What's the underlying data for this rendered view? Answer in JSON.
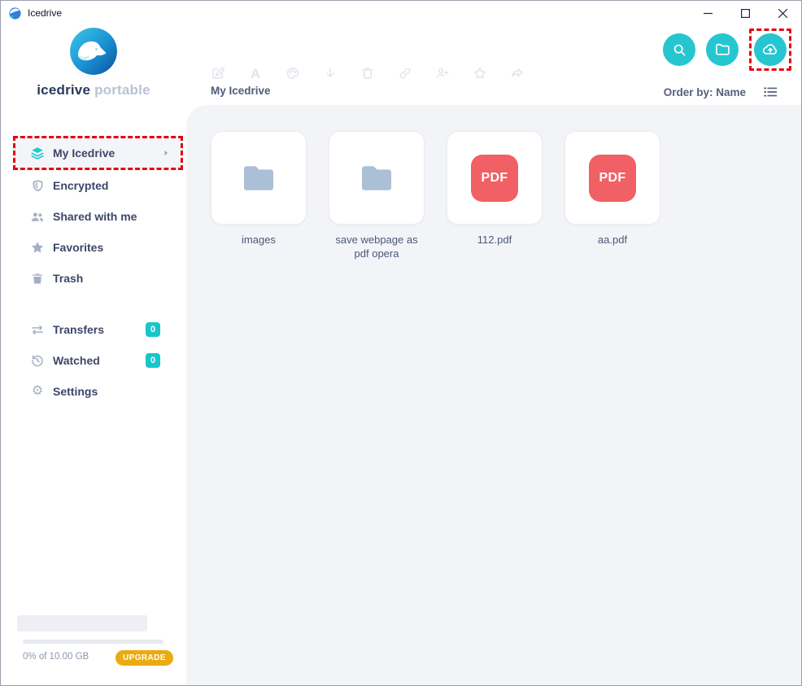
{
  "window": {
    "title": "Icedrive"
  },
  "sidebar": {
    "brand": {
      "name": "icedrive",
      "suffix": "portable"
    },
    "items": [
      {
        "label": "My Icedrive",
        "icon": "layers-icon",
        "selected": true
      },
      {
        "label": "Encrypted",
        "icon": "shield-icon"
      },
      {
        "label": "Shared with me",
        "icon": "users-icon"
      },
      {
        "label": "Favorites",
        "icon": "star-icon"
      },
      {
        "label": "Trash",
        "icon": "trash-icon"
      }
    ],
    "secondary": [
      {
        "label": "Transfers",
        "icon": "transfers-icon",
        "badge": "0"
      },
      {
        "label": "Watched",
        "icon": "history-icon",
        "badge": "0"
      },
      {
        "label": "Settings",
        "icon": "gear-icon"
      }
    ],
    "storage": {
      "usage": "0% of 10.00 GB",
      "percent_used": 0,
      "upgrade": "UPGRADE"
    }
  },
  "header": {
    "breadcrumb": "My Icedrive",
    "order_by": "Order by: Name",
    "rename_glyph": "A",
    "toolbar_icons": [
      "edit-icon",
      "rename-icon",
      "palette-icon",
      "download-icon",
      "delete-icon",
      "link-icon",
      "add-user-icon",
      "favorite-icon",
      "share-icon"
    ],
    "action_buttons": [
      "search-button",
      "new-folder-button",
      "upload-button"
    ]
  },
  "content": {
    "items": [
      {
        "name": "images",
        "type": "folder"
      },
      {
        "name": "save webpage as pdf opera",
        "type": "folder"
      },
      {
        "name": "112.pdf",
        "type": "pdf",
        "badge": "PDF"
      },
      {
        "name": "aa.pdf",
        "type": "pdf",
        "badge": "PDF"
      }
    ]
  },
  "annotations": {
    "color": "#e60513",
    "highlighted": [
      "sidebar-item-my-icedrive",
      "upload-button"
    ]
  },
  "colors": {
    "accent_teal": "#26c6d0",
    "badge_teal": "#19c5cc",
    "pdf_red": "#f16064",
    "folder_blue": "#abbfd6",
    "upgrade_yellow": "#e9ab10",
    "annotation_red": "#e60513",
    "content_bg": "#f3f4f7"
  }
}
